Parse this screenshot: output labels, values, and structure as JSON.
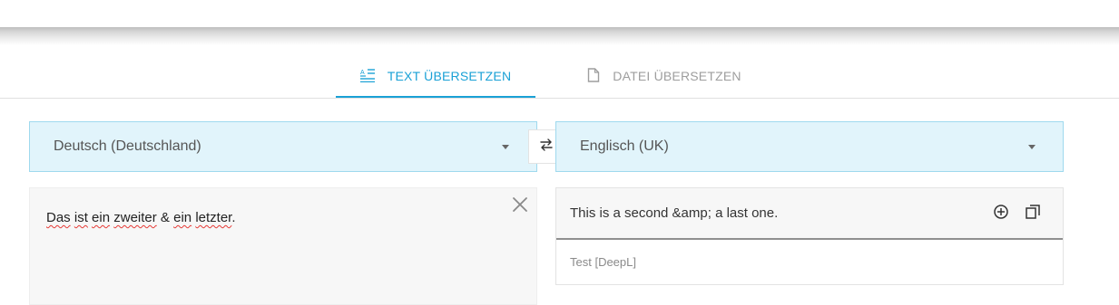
{
  "tabs": {
    "text_label": "TEXT ÜBERSETZEN",
    "file_label": "DATEI ÜBERSETZEN",
    "text_icon": "text-translate-icon",
    "file_icon": "document-icon"
  },
  "source": {
    "language": "Deutsch (Deutschland)",
    "text_words": [
      "Das",
      "ist",
      "ein",
      "zweiter",
      "&",
      "ein",
      "letzter",
      "."
    ],
    "text": "Das ist ein zweiter & ein letzter."
  },
  "target": {
    "language": "Englisch (UK)",
    "translation": "This is a second &amp; a last one.",
    "provider": "Test [DeepL]"
  },
  "icons": {
    "swap": "swap-icon",
    "clear": "close-icon",
    "add": "add-circle-icon",
    "copy": "copy-icon"
  },
  "colors": {
    "accent": "#1aa1d6",
    "lang_bg": "#e1f4fb",
    "spellcheck": "#e53935"
  }
}
